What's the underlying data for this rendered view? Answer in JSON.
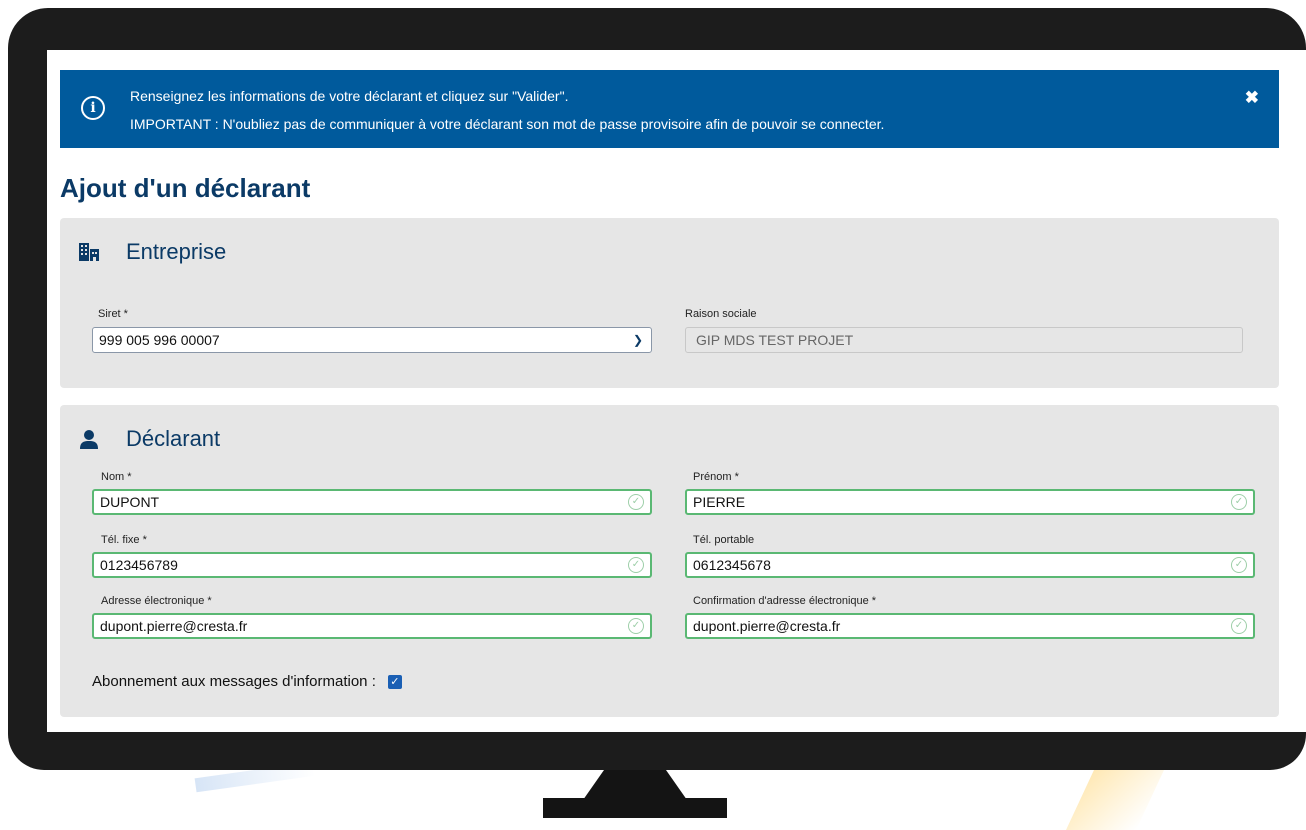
{
  "banner": {
    "line1": "Renseignez les informations de votre déclarant et cliquez sur \"Valider\".",
    "line2": "IMPORTANT : N'oubliez pas de communiquer à votre déclarant son mot de passe provisoire afin de pouvoir se connecter.",
    "info_icon": "i",
    "close_icon": "✖"
  },
  "page_title": "Ajout d'un déclarant",
  "entreprise": {
    "title": "Entreprise",
    "icon": "building-icon",
    "siret": {
      "label": "Siret *",
      "value": "999 005 996 00007"
    },
    "raison_sociale": {
      "label": "Raison sociale",
      "value": "GIP MDS TEST PROJET"
    }
  },
  "declarant": {
    "title": "Déclarant",
    "icon": "user-icon",
    "nom": {
      "label": "Nom *",
      "value": "DUPONT"
    },
    "prenom": {
      "label": "Prénom *",
      "value": "PIERRE"
    },
    "tel_fixe": {
      "label": "Tél. fixe *",
      "value": "0123456789"
    },
    "tel_portable": {
      "label": "Tél. portable",
      "value": "0612345678"
    },
    "email": {
      "label": "Adresse électronique *",
      "value": "dupont.pierre@cresta.fr"
    },
    "email_confirm": {
      "label": "Confirmation d'adresse électronique *",
      "value": "dupont.pierre@cresta.fr"
    },
    "subscription": {
      "label": "Abonnement aux messages d'information :",
      "checked": true
    }
  },
  "colors": {
    "banner": "#005a9c",
    "title": "#0b3a66",
    "card": "#e6e6e6",
    "valid_border": "#5ab873",
    "checkbox": "#1a5fb4"
  }
}
